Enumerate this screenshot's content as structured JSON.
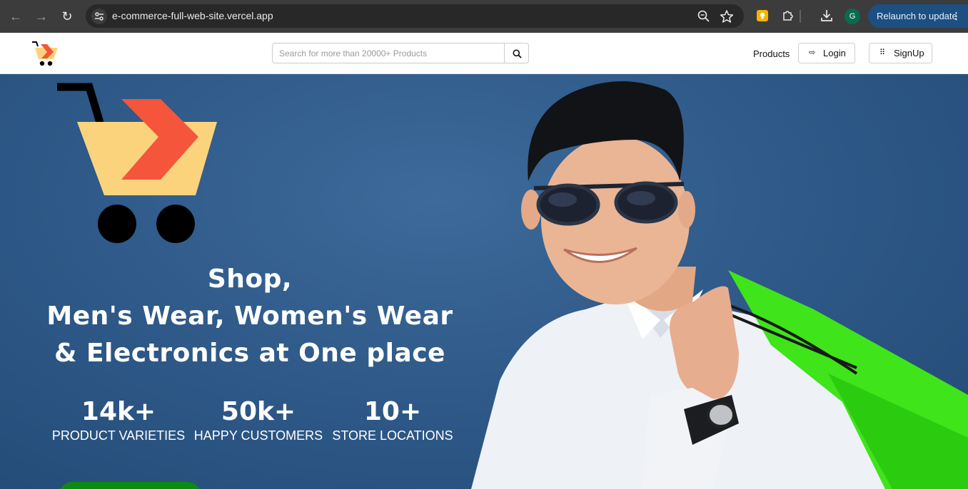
{
  "browser": {
    "url": "e-commerce-full-web-site.vercel.app",
    "profile_initial": "G",
    "relaunch_label": "Relaunch to update",
    "icons": [
      "back-arrow-icon",
      "forward-arrow-icon",
      "reload-icon",
      "site-settings-icon",
      "zoom-icon",
      "bookmark-star-icon",
      "keep-extension-icon",
      "extensions-puzzle-icon",
      "download-icon",
      "menu-dots-icon"
    ]
  },
  "header": {
    "search_placeholder": "Search for more than 20000+ Products",
    "nav_products": "Products",
    "login_label": "Login",
    "signup_label": "SignUp"
  },
  "hero": {
    "headline_line1": "Shop,",
    "headline_line2": "Men's Wear, Women's Wear",
    "headline_line3": "& Electronics at One place",
    "stats": [
      {
        "value": "14k+",
        "label": "PRODUCT VARIETIES"
      },
      {
        "value": "50k+",
        "label": "HAPPY CUSTOMERS"
      },
      {
        "value": "10+",
        "label": "STORE LOCATIONS"
      }
    ]
  },
  "colors": {
    "brand_yellow": "#fcd37d",
    "brand_orange": "#f4553b",
    "hero_blue": "#2f5a89",
    "cta_green": "#0c8a12",
    "bag_green": "#3fe41a",
    "chrome_dark": "#3c3c3c",
    "relaunch_blue": "#1d4f82"
  }
}
